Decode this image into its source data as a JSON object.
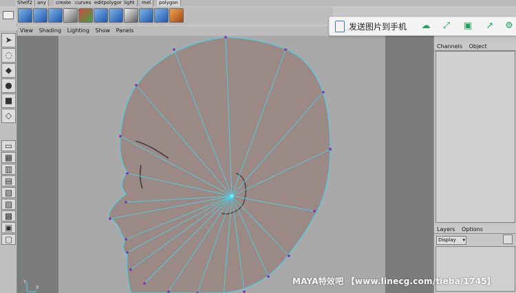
{
  "shelf_tabs": [
    "Shelf2",
    "any",
    "create",
    "curves",
    "editpolygon",
    "light",
    "mel",
    "polygon"
  ],
  "shelf_active_tab": "polygon",
  "viewport_menu": [
    "View",
    "Shading",
    "Lighting",
    "Show",
    "Panels"
  ],
  "channel_box": {
    "tabs": [
      "Channels",
      "Object"
    ]
  },
  "layer_editor": {
    "tabs": [
      "Layers",
      "Options"
    ],
    "display_value": "Display"
  },
  "overlay": {
    "label": "发送图片到手机"
  },
  "watermark": "MAYA特效吧 【www.linecg.com/tieba/1745】",
  "axis_labels": {
    "x": "X",
    "y": "Y"
  },
  "colors": {
    "wireframe": "#4fd1e8",
    "head_fill": "#9a8984",
    "vertex": "#7a2fb4",
    "overlay_icon": "#1aa35a"
  }
}
